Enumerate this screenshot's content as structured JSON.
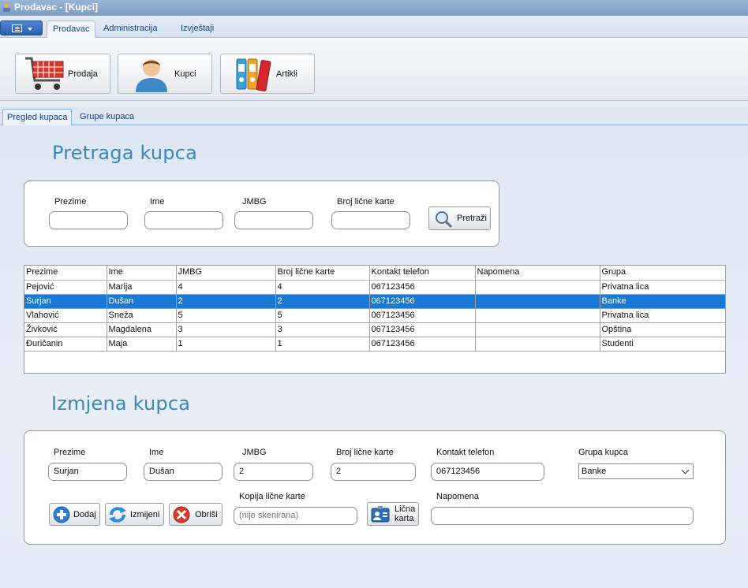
{
  "window": {
    "title": "Prodavac - [Kupci]"
  },
  "ribbon": {
    "tabs": [
      "Prodavac",
      "Administracija",
      "Izvještaji"
    ],
    "active_tab": "Prodavac",
    "buttons": [
      {
        "label": "Prodaja",
        "icon": "shopping-cart-icon"
      },
      {
        "label": "Kupci",
        "icon": "person-icon"
      },
      {
        "label": "Artikli",
        "icon": "binders-icon"
      }
    ]
  },
  "subtabs": [
    "Pregled kupaca",
    "Grupe kupaca"
  ],
  "search": {
    "title": "Pretraga kupca",
    "labels": {
      "prezime": "Prezime",
      "ime": "Ime",
      "jmbg": "JMBG",
      "broj_licne": "Broj lične karte"
    },
    "values": {
      "prezime": "",
      "ime": "",
      "jmbg": "",
      "broj_licne": ""
    },
    "button": "Pretraži"
  },
  "grid": {
    "columns": [
      "Prezime",
      "Ime",
      "JMBG",
      "Broj lične karte",
      "Kontakt telefon",
      "Napomena",
      "Grupa"
    ],
    "rows": [
      [
        "Pejović",
        "Marija",
        "4",
        "4",
        "067123456",
        "",
        "Privatna lica"
      ],
      [
        "Surjan",
        "Dušan",
        "2",
        "2",
        "067123456",
        "",
        "Banke"
      ],
      [
        "Vlahović",
        "Sneža",
        "5",
        "5",
        "067123456",
        "",
        "Privatna lica"
      ],
      [
        "Živković",
        "Magdalena",
        "3",
        "3",
        "067123456",
        "",
        "Opština"
      ],
      [
        "Đuričanin",
        "Maja",
        "1",
        "1",
        "067123456",
        "",
        "Studenti"
      ]
    ],
    "selected_row": 1
  },
  "edit": {
    "title": "Izmjena kupca",
    "labels": {
      "prezime": "Prezime",
      "ime": "Ime",
      "jmbg": "JMBG",
      "broj_licne": "Broj lične karte",
      "kontakt": "Kontakt telefon",
      "grupa": "Grupa kupca",
      "kopija": "Kopija lične karte",
      "napomena": "Napomena"
    },
    "values": {
      "prezime": "Surjan",
      "ime": "Dušan",
      "jmbg": "2",
      "broj_licne": "2",
      "kontakt": "067123456",
      "grupa": "Banke",
      "kopija": "(nije skenirana)",
      "napomena": ""
    },
    "buttons": {
      "dodaj": "Dodaj",
      "izmijeni": "Izmijeni",
      "obrisi": "Obriši",
      "licna_line1": "Lična",
      "licna_line2": "karta"
    }
  }
}
